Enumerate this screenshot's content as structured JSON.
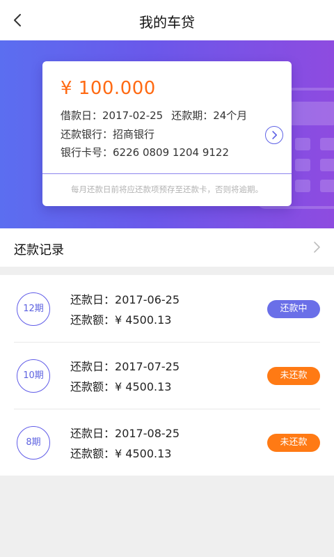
{
  "header": {
    "title": "我的车贷",
    "back_icon": "chevron-left-icon"
  },
  "loan": {
    "amount": "¥ 100.000",
    "loan_date_label": "借款日：",
    "loan_date": "2017-02-25",
    "term_label": "还款期：",
    "term": "24个月",
    "bank_label": "还款银行：",
    "bank": "招商银行",
    "card_label": "银行卡号：",
    "card_number": "6226 0809 1204 9122",
    "notice": "每月还款日前将应还款项预存至还款卡，否则将逾期。",
    "detail_icon": "chevron-right-circle-icon"
  },
  "records": {
    "title": "还款记录",
    "chevron_icon": "chevron-right-icon",
    "items": [
      {
        "period": "12期",
        "due_label": "还款日：",
        "due_date": "2017-06-25",
        "amount_label": "还款额：",
        "amount": "¥ 4500.13",
        "status": "还款中",
        "status_color": "#6a6fe8"
      },
      {
        "period": "10期",
        "due_label": "还款日：",
        "due_date": "2017-07-25",
        "amount_label": "还款额：",
        "amount": "¥ 4500.13",
        "status": "未还款",
        "status_color": "#ff7a14"
      },
      {
        "period": "8期",
        "due_label": "还款日：",
        "due_date": "2017-08-25",
        "amount_label": "还款额：",
        "amount": "¥ 4500.13",
        "status": "未还款",
        "status_color": "#ff7a14"
      }
    ]
  },
  "colors": {
    "accent": "#6466e8",
    "amount": "#ff6a13",
    "background": "#efefef"
  }
}
